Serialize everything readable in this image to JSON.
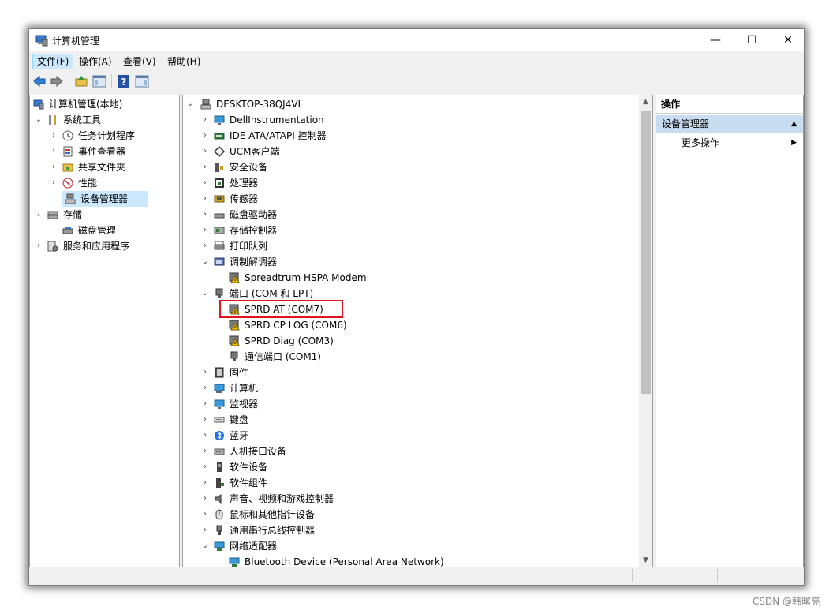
{
  "window": {
    "title": "计算机管理",
    "minimize_glyph": "—",
    "maximize_glyph": "☐",
    "close_glyph": "✕"
  },
  "menu": [
    "文件(F)",
    "操作(A)",
    "查看(V)",
    "帮助(H)"
  ],
  "left_tree": {
    "root": "计算机管理(本地)",
    "items": [
      {
        "label": "系统工具",
        "level": 1,
        "expander": "open",
        "icon": "tools-icon"
      },
      {
        "label": "任务计划程序",
        "level": 2,
        "expander": "closed",
        "icon": "clock-icon"
      },
      {
        "label": "事件查看器",
        "level": 2,
        "expander": "closed",
        "icon": "event-viewer-icon"
      },
      {
        "label": "共享文件夹",
        "level": 2,
        "expander": "closed",
        "icon": "shared-folder-icon"
      },
      {
        "label": "性能",
        "level": 2,
        "expander": "closed",
        "icon": "performance-icon"
      },
      {
        "label": "设备管理器",
        "level": 2,
        "expander": "none",
        "icon": "device-manager-icon",
        "selected": true
      },
      {
        "label": "存储",
        "level": 1,
        "expander": "open",
        "icon": "storage-icon"
      },
      {
        "label": "磁盘管理",
        "level": 2,
        "expander": "none",
        "icon": "disk-icon"
      },
      {
        "label": "服务和应用程序",
        "level": 1,
        "expander": "closed",
        "icon": "services-icon"
      }
    ]
  },
  "device_tree": {
    "root": "DESKTOP-38QJ4VI",
    "items": [
      {
        "label": "DellInstrumentation",
        "level": 1,
        "expander": "closed",
        "icon": "monitor-icon"
      },
      {
        "label": "IDE ATA/ATAPI 控制器",
        "level": 1,
        "expander": "closed",
        "icon": "ide-controller-icon"
      },
      {
        "label": "UCM客户端",
        "level": 1,
        "expander": "closed",
        "icon": "ucm-icon"
      },
      {
        "label": "安全设备",
        "level": 1,
        "expander": "closed",
        "icon": "security-device-icon"
      },
      {
        "label": "处理器",
        "level": 1,
        "expander": "closed",
        "icon": "processor-icon"
      },
      {
        "label": "传感器",
        "level": 1,
        "expander": "closed",
        "icon": "sensor-icon"
      },
      {
        "label": "磁盘驱动器",
        "level": 1,
        "expander": "closed",
        "icon": "disk-drive-icon"
      },
      {
        "label": "存储控制器",
        "level": 1,
        "expander": "closed",
        "icon": "storage-controller-icon"
      },
      {
        "label": "打印队列",
        "level": 1,
        "expander": "closed",
        "icon": "printer-icon"
      },
      {
        "label": "调制解调器",
        "level": 1,
        "expander": "open",
        "icon": "modem-icon"
      },
      {
        "label": "Spreadtrum HSPA Modem",
        "level": 2,
        "expander": "none",
        "icon": "warning-device-icon"
      },
      {
        "label": "端口 (COM 和 LPT)",
        "level": 1,
        "expander": "open",
        "icon": "port-icon"
      },
      {
        "label": "SPRD AT (COM7)",
        "level": 2,
        "expander": "none",
        "icon": "warning-device-icon",
        "highlighted": true
      },
      {
        "label": "SPRD CP LOG (COM6)",
        "level": 2,
        "expander": "none",
        "icon": "warning-device-icon"
      },
      {
        "label": "SPRD Diag (COM3)",
        "level": 2,
        "expander": "none",
        "icon": "warning-device-icon"
      },
      {
        "label": "通信端口 (COM1)",
        "level": 2,
        "expander": "none",
        "icon": "port-icon"
      },
      {
        "label": "固件",
        "level": 1,
        "expander": "closed",
        "icon": "firmware-icon"
      },
      {
        "label": "计算机",
        "level": 1,
        "expander": "closed",
        "icon": "computer-icon"
      },
      {
        "label": "监视器",
        "level": 1,
        "expander": "closed",
        "icon": "monitor-icon"
      },
      {
        "label": "键盘",
        "level": 1,
        "expander": "closed",
        "icon": "keyboard-icon"
      },
      {
        "label": "蓝牙",
        "level": 1,
        "expander": "closed",
        "icon": "bluetooth-icon"
      },
      {
        "label": "人机接口设备",
        "level": 1,
        "expander": "closed",
        "icon": "hid-icon"
      },
      {
        "label": "软件设备",
        "level": 1,
        "expander": "closed",
        "icon": "software-device-icon"
      },
      {
        "label": "软件组件",
        "level": 1,
        "expander": "closed",
        "icon": "software-component-icon"
      },
      {
        "label": "声音、视频和游戏控制器",
        "level": 1,
        "expander": "closed",
        "icon": "speaker-icon"
      },
      {
        "label": "鼠标和其他指针设备",
        "level": 1,
        "expander": "closed",
        "icon": "mouse-icon"
      },
      {
        "label": "通用串行总线控制器",
        "level": 1,
        "expander": "closed",
        "icon": "usb-icon"
      },
      {
        "label": "网络适配器",
        "level": 1,
        "expander": "open",
        "icon": "network-adapter-icon"
      },
      {
        "label": "Bluetooth Device (Personal Area Network)",
        "level": 2,
        "expander": "none",
        "icon": "network-adapter-icon"
      }
    ]
  },
  "actions": {
    "header": "操作",
    "section": "设备管理器",
    "more": "更多操作"
  },
  "watermark": "CSDN @韩曙亮",
  "colors": {
    "selection": "#cce8ff",
    "highlight_box": "#e0141e",
    "action_section": "#c9ddf1"
  }
}
